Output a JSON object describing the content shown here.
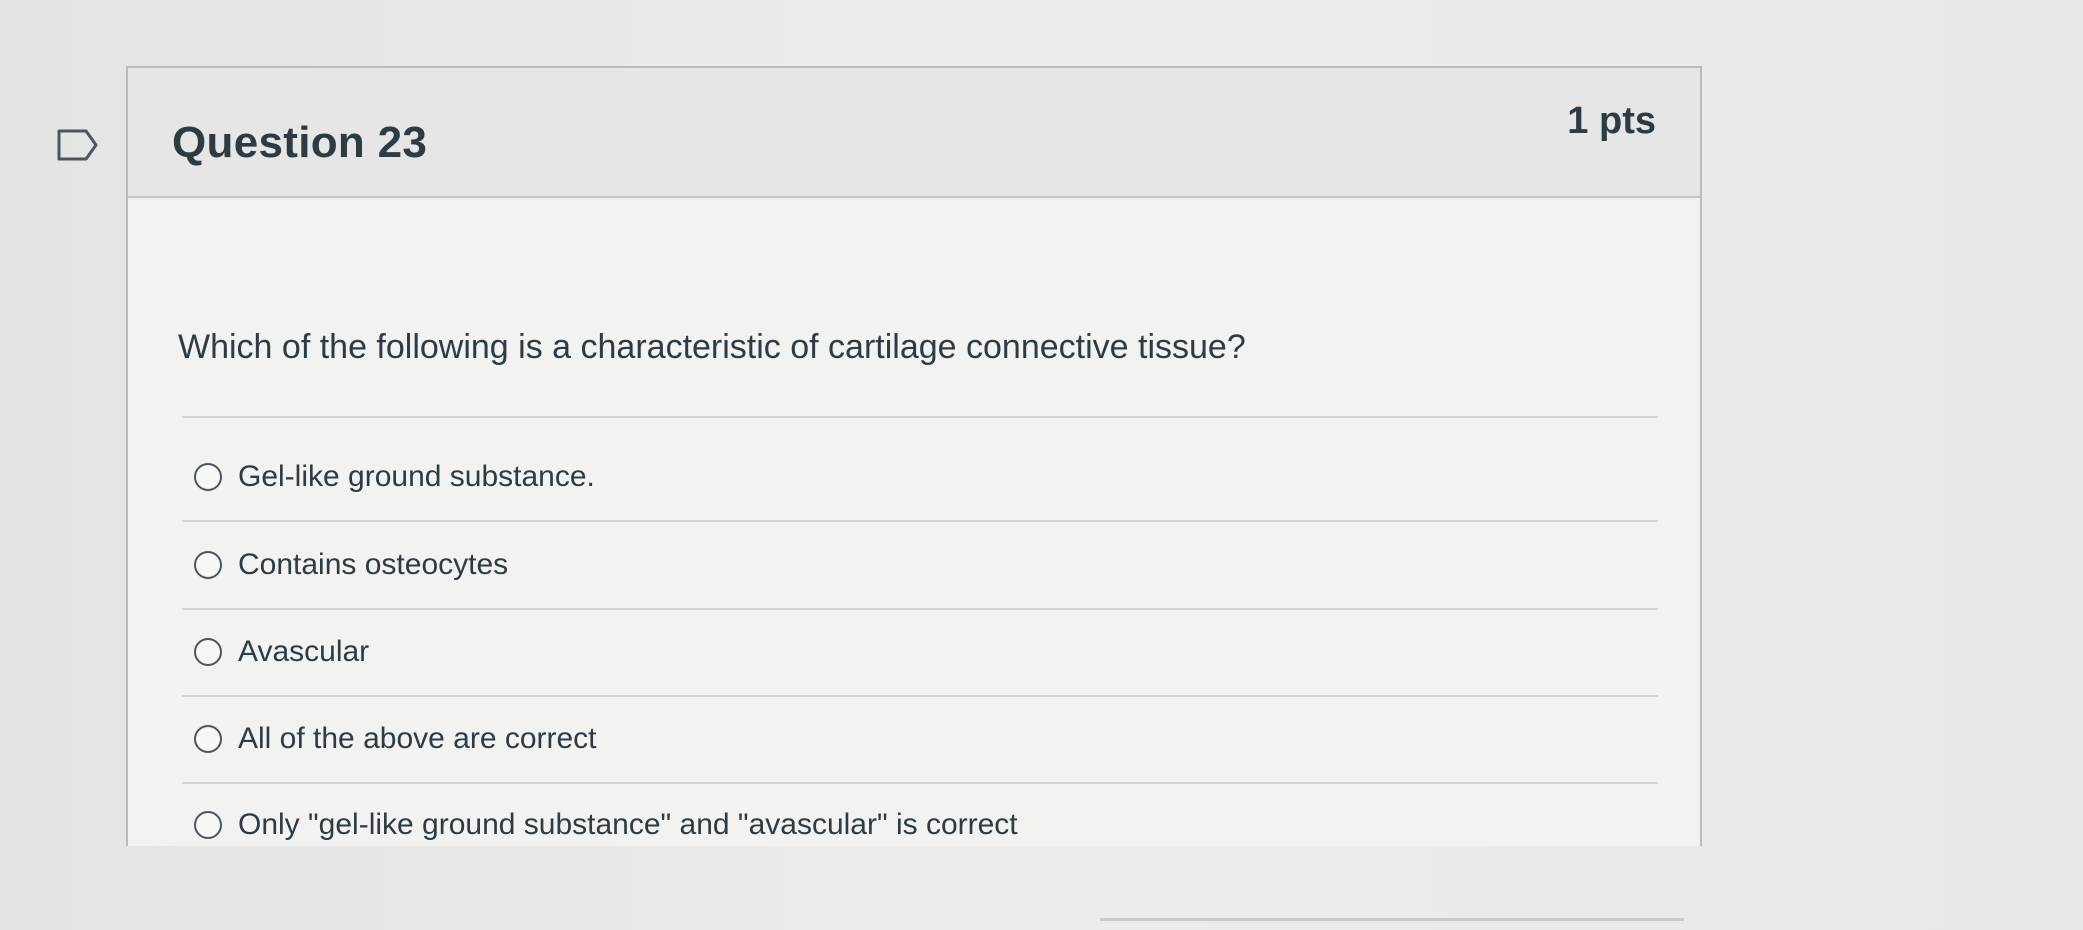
{
  "question": {
    "title": "Question 23",
    "points": "1 pts",
    "text": "Which of the following is a characteristic of cartilage connective tissue?",
    "flag_icon": "bookmark-flag-icon",
    "answers": [
      {
        "label": "Gel-like ground substance."
      },
      {
        "label": "Contains osteocytes"
      },
      {
        "label": "Avascular"
      },
      {
        "label": "All of the above are correct"
      },
      {
        "label": "Only \"gel-like ground substance\" and \"avascular\" is correct"
      }
    ]
  }
}
